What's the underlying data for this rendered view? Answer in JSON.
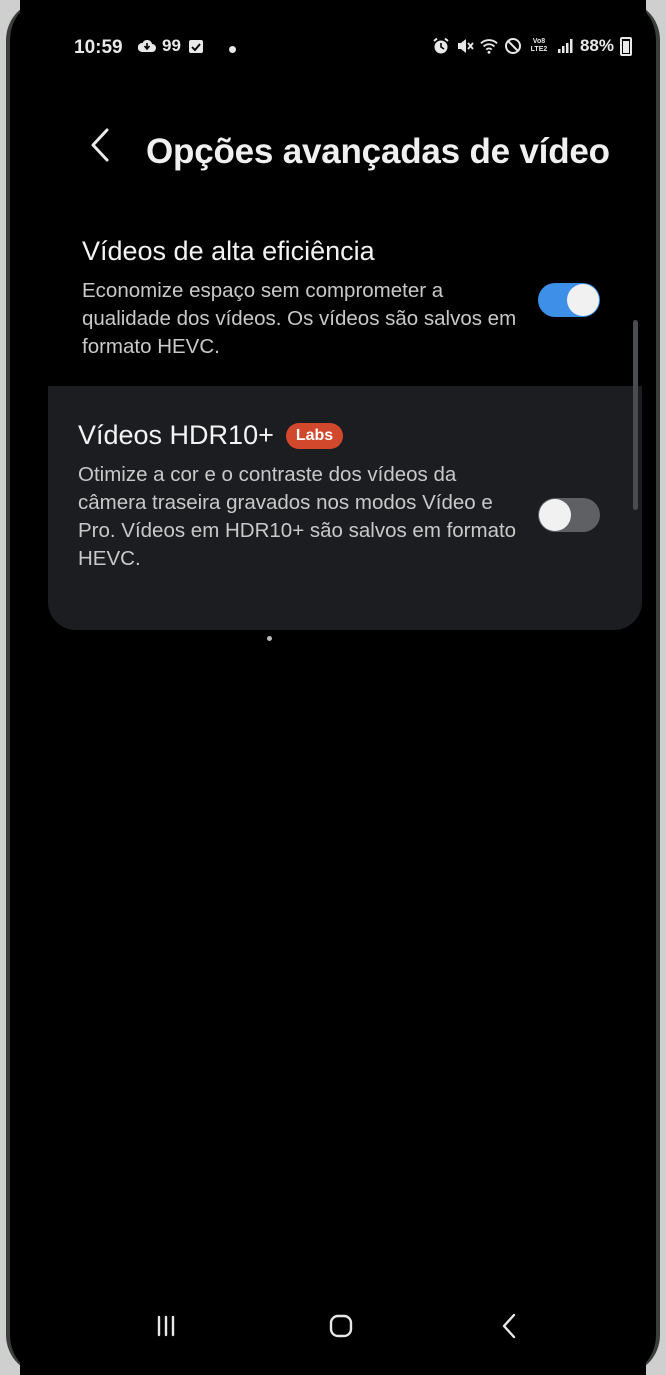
{
  "status_bar": {
    "time": "10:59",
    "notification_count": "99",
    "battery": "88%",
    "left_icons": [
      "cloud-icon",
      "calendar-icon",
      "dot-icon"
    ],
    "right_icons": [
      "alarm-icon",
      "mute-icon",
      "wifi-icon",
      "dnd-icon",
      "volte-icon",
      "signal-icon",
      "battery-icon"
    ],
    "volte_label": "Vo8 LTE2"
  },
  "header": {
    "back_icon": "chevron-left-icon",
    "title": "Opções avançadas de vídeo"
  },
  "settings": [
    {
      "title": "Vídeos de alta eficiência",
      "description": "Economize espaço sem comprometer a qualidade dos vídeos. Os vídeos são salvos em formato HEVC.",
      "enabled": true
    },
    {
      "title": "Vídeos HDR10+",
      "badge": "Labs",
      "description": "Otimize a cor e o contraste dos vídeos da câmera traseira gravados nos modos Vídeo e Pro. Vídeos em HDR10+ são salvos em formato HEVC.",
      "enabled": false
    }
  ],
  "nav_bar": {
    "recents_icon": "recents-icon",
    "home_icon": "home-icon",
    "back_icon": "back-icon"
  },
  "colors": {
    "toggle_on": "#3e8fe8",
    "toggle_off": "#5e6064",
    "labs_badge": "#d2482d",
    "card_bg": "#1b1d20"
  }
}
